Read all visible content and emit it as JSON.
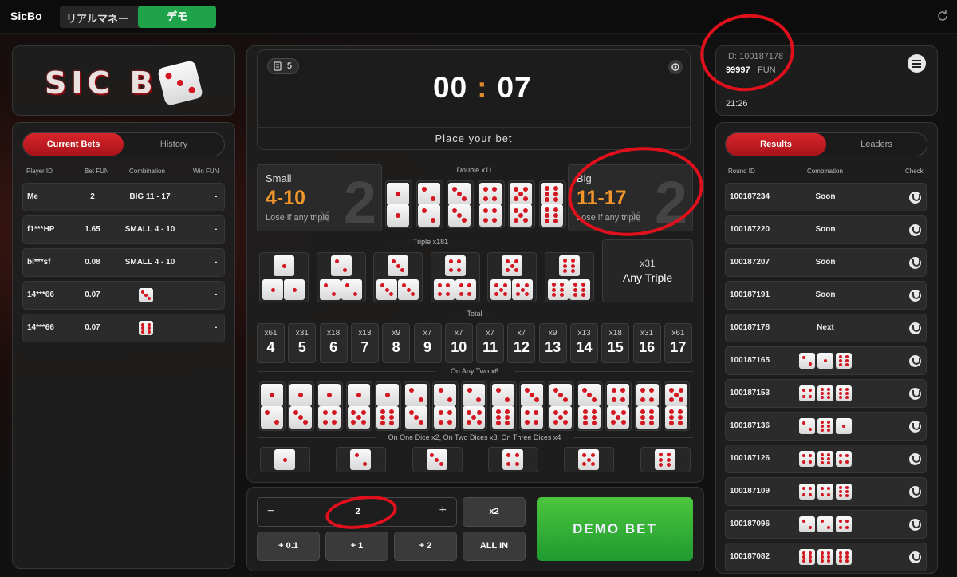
{
  "topbar": {
    "title": "SicBo",
    "mode_real": "リアルマネー",
    "mode_demo": "デモ"
  },
  "logo": {
    "text": "SIC B"
  },
  "bets": {
    "tab_active": "Current Bets",
    "tab_inactive": "History",
    "headers": {
      "player": "Player ID",
      "bet": "Bet  FUN",
      "combination": "Combination",
      "win": "Win  FUN"
    },
    "rows": [
      {
        "player": "Me",
        "bet": "2",
        "combination": "BIG 11 - 17",
        "win": "-"
      },
      {
        "player": "f1***HP",
        "bet": "1.65",
        "combination": "SMALL 4 - 10",
        "win": "-"
      },
      {
        "player": "bi***sf",
        "bet": "0.08",
        "combination": "SMALL 4 - 10",
        "win": "-"
      },
      {
        "player": "14***66",
        "bet": "0.07",
        "combination": "",
        "win": "-"
      },
      {
        "player": "14***66",
        "bet": "0.07",
        "combination": "",
        "win": "-"
      }
    ]
  },
  "timer": {
    "round": "5",
    "minutes": "00",
    "seconds": "07",
    "status": "Place your bet"
  },
  "board": {
    "small": {
      "label": "Small",
      "range": "4-10",
      "note": "Lose if any triple",
      "mult": "2",
      "x": "x"
    },
    "big": {
      "label": "Big",
      "range": "11-17",
      "note": "Lose if any triple",
      "mult": "2",
      "x": "x"
    },
    "double_header": "Double x11",
    "triple_header": "Triple x181",
    "any_triple": {
      "mult": "x31",
      "label": "Any Triple"
    },
    "total_header": "Total",
    "totals": [
      {
        "m": "x61",
        "n": "4"
      },
      {
        "m": "x31",
        "n": "5"
      },
      {
        "m": "x18",
        "n": "6"
      },
      {
        "m": "x13",
        "n": "7"
      },
      {
        "m": "x9",
        "n": "8"
      },
      {
        "m": "x7",
        "n": "9"
      },
      {
        "m": "x7",
        "n": "10"
      },
      {
        "m": "x7",
        "n": "11"
      },
      {
        "m": "x7",
        "n": "12"
      },
      {
        "m": "x9",
        "n": "13"
      },
      {
        "m": "x13",
        "n": "14"
      },
      {
        "m": "x18",
        "n": "15"
      },
      {
        "m": "x31",
        "n": "16"
      },
      {
        "m": "x61",
        "n": "17"
      }
    ],
    "any_two_header": "On Any Two x6",
    "single_header": "On One Dice x2, On Two Dices x3, On Three Dices x4"
  },
  "betctrl": {
    "minus": "−",
    "value": "2",
    "plus": "+",
    "x2": "x2",
    "add01": "+ 0.1",
    "add1": "+ 1",
    "add2": "+ 2",
    "allin": "ALL IN",
    "demo_bet": "DEMO BET"
  },
  "account": {
    "id": "ID: 100187178",
    "balance": "99997",
    "currency": "FUN",
    "time": "21:26"
  },
  "results": {
    "tab_active": "Results",
    "tab_inactive": "Leaders",
    "headers": {
      "round": "Round ID",
      "combination": "Combination",
      "check": "Check"
    },
    "rows": [
      {
        "round": "100187234",
        "combination": "Soon"
      },
      {
        "round": "100187220",
        "combination": "Soon"
      },
      {
        "round": "100187207",
        "combination": "Soon"
      },
      {
        "round": "100187191",
        "combination": "Soon"
      },
      {
        "round": "100187178",
        "combination": "Next"
      },
      {
        "round": "100187165",
        "combination": ""
      },
      {
        "round": "100187153",
        "combination": ""
      },
      {
        "round": "100187136",
        "combination": ""
      },
      {
        "round": "100187126",
        "combination": ""
      },
      {
        "round": "100187109",
        "combination": ""
      },
      {
        "round": "100187096",
        "combination": ""
      },
      {
        "round": "100187082",
        "combination": ""
      }
    ]
  },
  "colors": {
    "accent_red": "#d7252b",
    "demo_green": "#1fa34a",
    "orange": "#f0962a",
    "pip": "#d31620"
  },
  "icons": [
    "refresh-icon",
    "calendar-icon",
    "settings-icon",
    "menu-icon",
    "check-shield-icon"
  ]
}
